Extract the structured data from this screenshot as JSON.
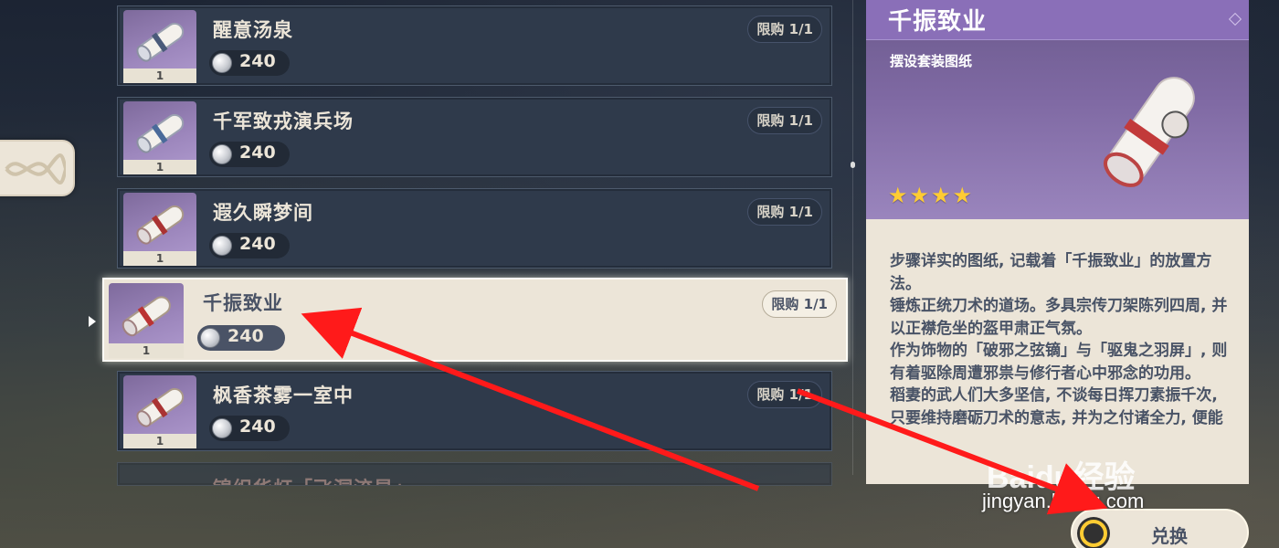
{
  "shop": {
    "items": [
      {
        "name": "醒意汤泉",
        "count": "1",
        "price": "240",
        "limit": "限购 1/1"
      },
      {
        "name": "千军致戎演兵场",
        "count": "1",
        "price": "240",
        "limit": "限购 1/1"
      },
      {
        "name": "遐久瞬梦间",
        "count": "1",
        "price": "240",
        "limit": "限购 1/1"
      },
      {
        "name": "千振致业",
        "count": "1",
        "price": "240",
        "limit": "限购 1/1",
        "selected": true
      },
      {
        "name": "枫香茶雾一室中",
        "count": "1",
        "price": "240",
        "limit": "限购 1/1"
      },
      {
        "name": "锦织华灯「飞洞流星」",
        "partial": true
      }
    ]
  },
  "detail": {
    "title": "千振致业",
    "subtitle": "摆设套装图纸",
    "stars": "★★★★",
    "rarity": 4,
    "description": [
      "步骤详实的图纸, 记载着「千振致业」的放置方法。",
      "锤炼正统刀术的道场。多具宗传刀架陈列四周, 并以正襟危坐的盔甲肃正气氛。",
      "作为饰物的「破邪之弦镝」与「驱鬼之羽屏」, 则有着驱除周遭邪祟与修行者心中邪念的功用。",
      "稻妻的武人们大多坚信, 不谈每日挥刀素振千次, 只要维持磨砺刀术的意志, 并为之付诸全力, 便能"
    ]
  },
  "action": {
    "label": "兑换"
  },
  "watermark": {
    "logo": "Baidu经验",
    "url": "jingyan.baidu.com"
  },
  "colors": {
    "panel_purple": "#8a6fb8",
    "cream": "#ece5d8",
    "star": "#ffcc33",
    "arrow": "#ff1a1a"
  }
}
